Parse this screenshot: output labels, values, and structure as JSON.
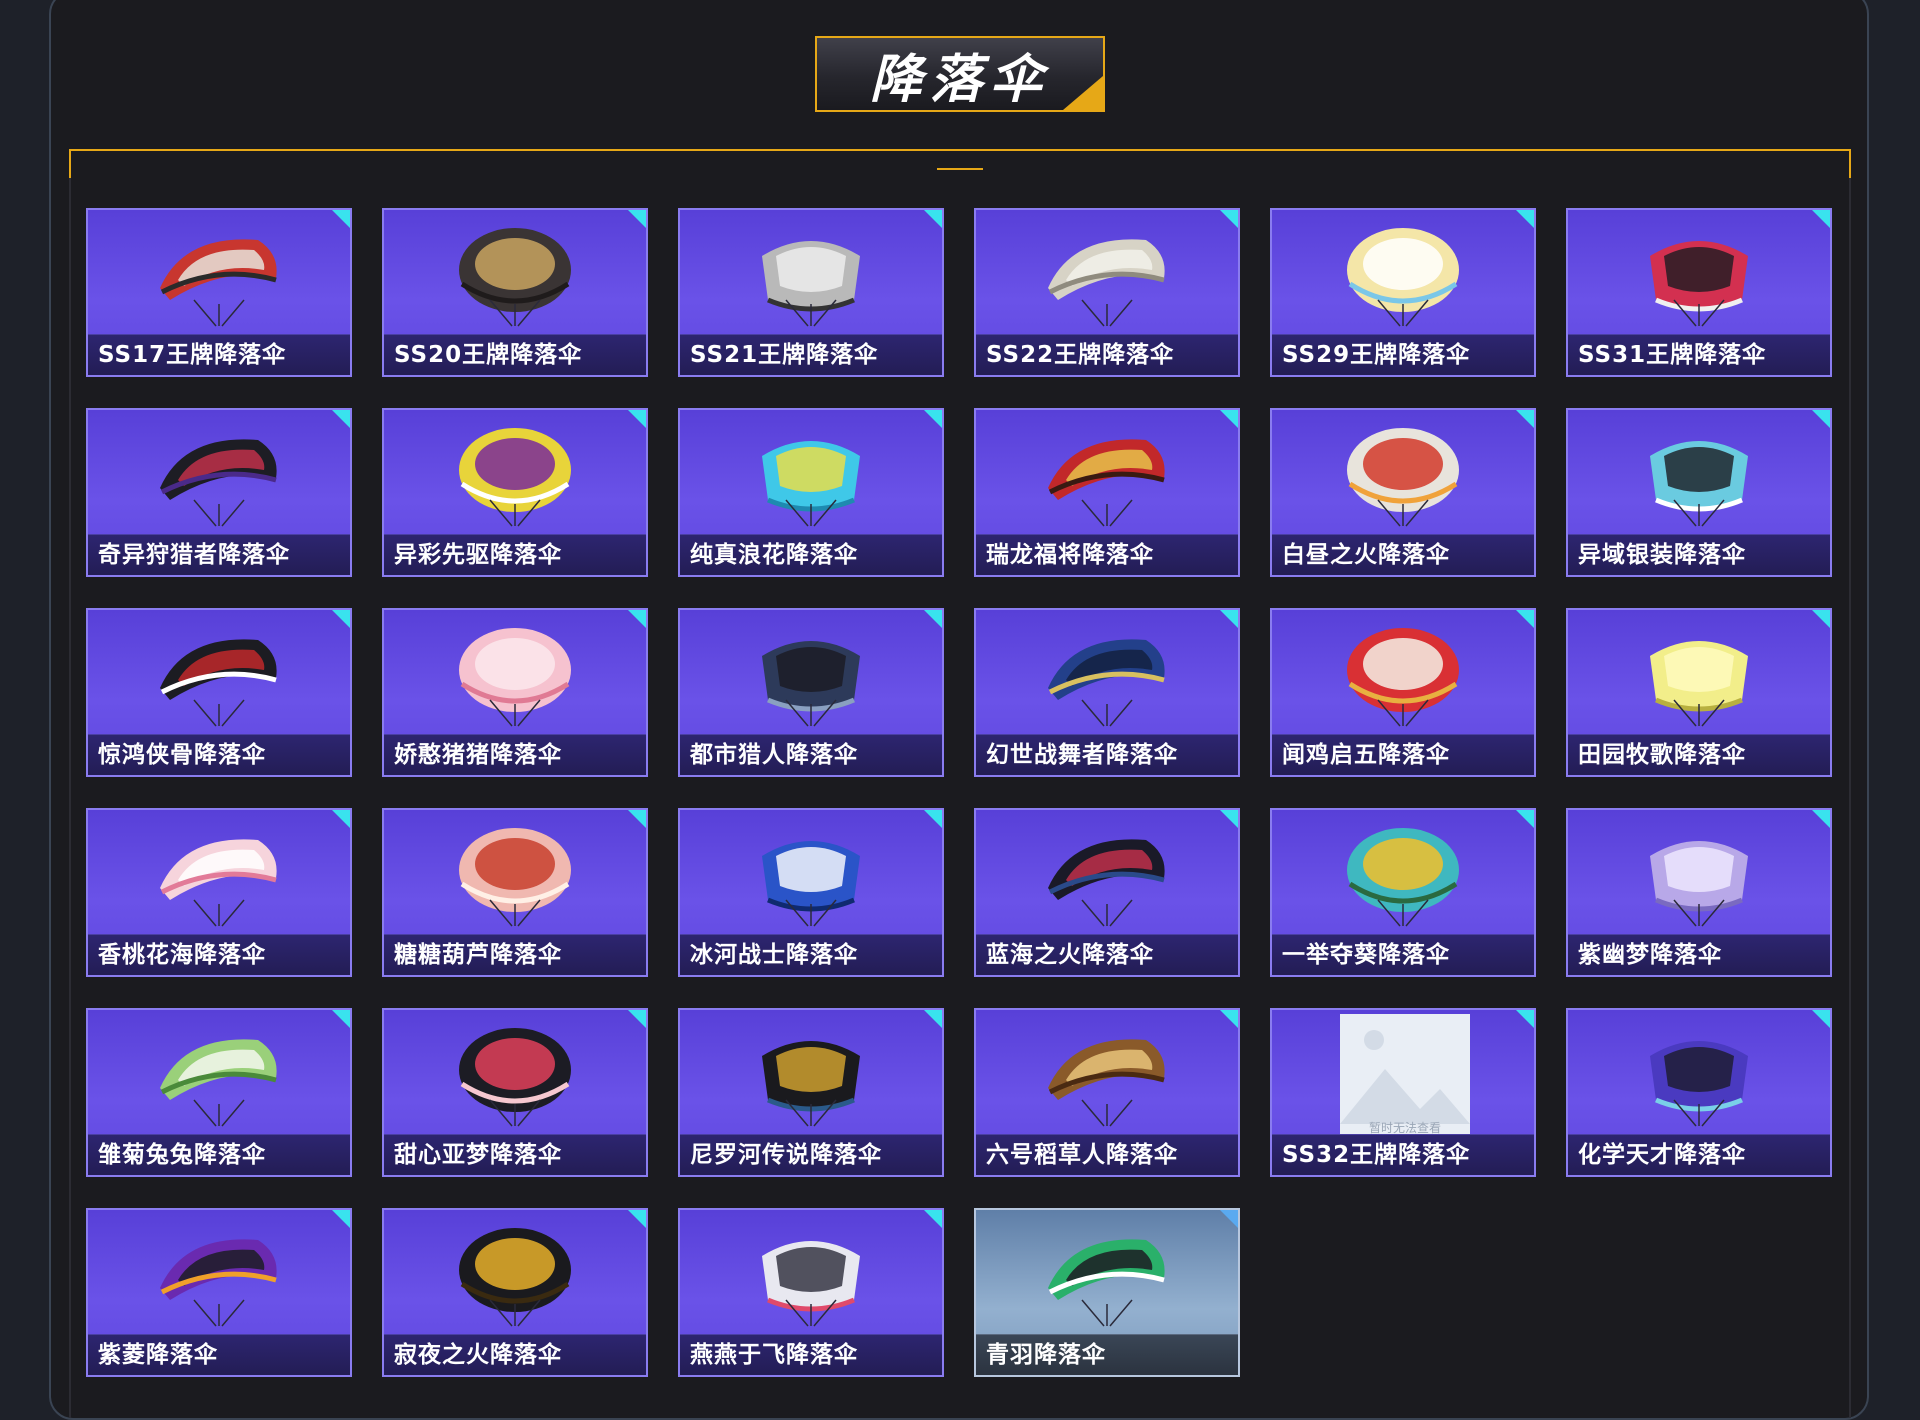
{
  "header": {
    "title": "降落伞"
  },
  "items": [
    {
      "label": "SS17王牌降落伞",
      "colors": [
        "#c8362f",
        "#e8e3da",
        "#2a2a2a"
      ]
    },
    {
      "label": "SS20王牌降落伞",
      "colors": [
        "#3a3434",
        "#c9a560",
        "#1f1b1b"
      ]
    },
    {
      "label": "SS21王牌降落伞",
      "colors": [
        "#b9b9b9",
        "#f0f0f0",
        "#333333"
      ]
    },
    {
      "label": "SS22王牌降落伞",
      "colors": [
        "#d7d3c6",
        "#f2f1ea",
        "#8f8b7e"
      ]
    },
    {
      "label": "SS29王牌降落伞",
      "colors": [
        "#f4e6a8",
        "#ffffff",
        "#7ac7e8"
      ]
    },
    {
      "label": "SS31王牌降落伞",
      "colors": [
        "#d33050",
        "#1b1b20",
        "#f0f0f0"
      ]
    },
    {
      "label": "奇异狩猎者降落伞",
      "colors": [
        "#1d1d24",
        "#c0304a",
        "#4a2a8a"
      ]
    },
    {
      "label": "异彩先驱降落伞",
      "colors": [
        "#e8d43a",
        "#7a2a9a",
        "#ffffff"
      ]
    },
    {
      "label": "纯真浪花降落伞",
      "colors": [
        "#3fc8e8",
        "#f2e040",
        "#1e8ab0"
      ]
    },
    {
      "label": "瑞龙福将降落伞",
      "colors": [
        "#c2282a",
        "#e8c24a",
        "#3a1a12"
      ]
    },
    {
      "label": "白昼之火降落伞",
      "colors": [
        "#e8e4dc",
        "#d23a2a",
        "#f0a23a"
      ]
    },
    {
      "label": "异域银装降落伞",
      "colors": [
        "#6acbe0",
        "#1c1c22",
        "#ffffff"
      ]
    },
    {
      "label": "惊鸿侠骨降落伞",
      "colors": [
        "#1c1c22",
        "#c0282a",
        "#ffffff"
      ]
    },
    {
      "label": "娇憨猪猪降落伞",
      "colors": [
        "#f6c2cf",
        "#fbe7ec",
        "#e07a94"
      ]
    },
    {
      "label": "都市猎人降落伞",
      "colors": [
        "#2d3a5a",
        "#1a1a22",
        "#8aa0c0"
      ]
    },
    {
      "label": "幻世战舞者降落伞",
      "colors": [
        "#23408a",
        "#13213f",
        "#d8c060"
      ]
    },
    {
      "label": "闻鸡启五降落伞",
      "colors": [
        "#d93034",
        "#f4f0e6",
        "#e8b040"
      ]
    },
    {
      "label": "田园牧歌降落伞",
      "colors": [
        "#f2ee8a",
        "#fffbc0",
        "#b8b040"
      ]
    },
    {
      "label": "香桃花海降落伞",
      "colors": [
        "#f6d4dc",
        "#ffffff",
        "#e27a98"
      ]
    },
    {
      "label": "糖糖葫芦降落伞",
      "colors": [
        "#f0b8b0",
        "#c8402e",
        "#fff0e6"
      ]
    },
    {
      "label": "冰河战士降落伞",
      "colors": [
        "#2a54c8",
        "#ffffff",
        "#0f2a70"
      ]
    },
    {
      "label": "蓝海之火降落伞",
      "colors": [
        "#1a1a28",
        "#c0304a",
        "#2a4a8a"
      ]
    },
    {
      "label": "一举夺葵降落伞",
      "colors": [
        "#3fb8c0",
        "#f2c02a",
        "#2a6a40"
      ]
    },
    {
      "label": "紫幽梦降落伞",
      "colors": [
        "#b8a8e8",
        "#f0eaff",
        "#7a6ac0"
      ]
    },
    {
      "label": "雏菊兔兔降落伞",
      "colors": [
        "#9ad07a",
        "#f4f8ee",
        "#4a8a3a"
      ]
    },
    {
      "label": "甜心亚梦降落伞",
      "colors": [
        "#1c1c24",
        "#e0405a",
        "#f6c8d0"
      ]
    },
    {
      "label": "尼罗河传说降落伞",
      "colors": [
        "#1a1a1e",
        "#d8a830",
        "#2a5a8a"
      ]
    },
    {
      "label": "六号稻草人降落伞",
      "colors": [
        "#8a5a2a",
        "#e8c47a",
        "#4a2a12"
      ]
    },
    {
      "label": "SS32王牌降落伞",
      "placeholder": true,
      "placeholder_text": "暂时无法查看"
    },
    {
      "label": "化学天才降落伞",
      "colors": [
        "#4a3ac0",
        "#1c1c2a",
        "#7ad0e8"
      ]
    },
    {
      "label": "紫菱降落伞",
      "colors": [
        "#6a2ab0",
        "#1c1c24",
        "#f0a02a"
      ]
    },
    {
      "label": "寂夜之火降落伞",
      "colors": [
        "#1a1a1e",
        "#e8b02a",
        "#3a2a10"
      ]
    },
    {
      "label": "燕燕于飞降落伞",
      "colors": [
        "#e8e8f0",
        "#2a2a3a",
        "#e04a6a"
      ]
    },
    {
      "label": "青羽降落伞",
      "colors": [
        "#2ab06a",
        "#1c1c22",
        "#ffffff"
      ],
      "alt": true
    }
  ]
}
